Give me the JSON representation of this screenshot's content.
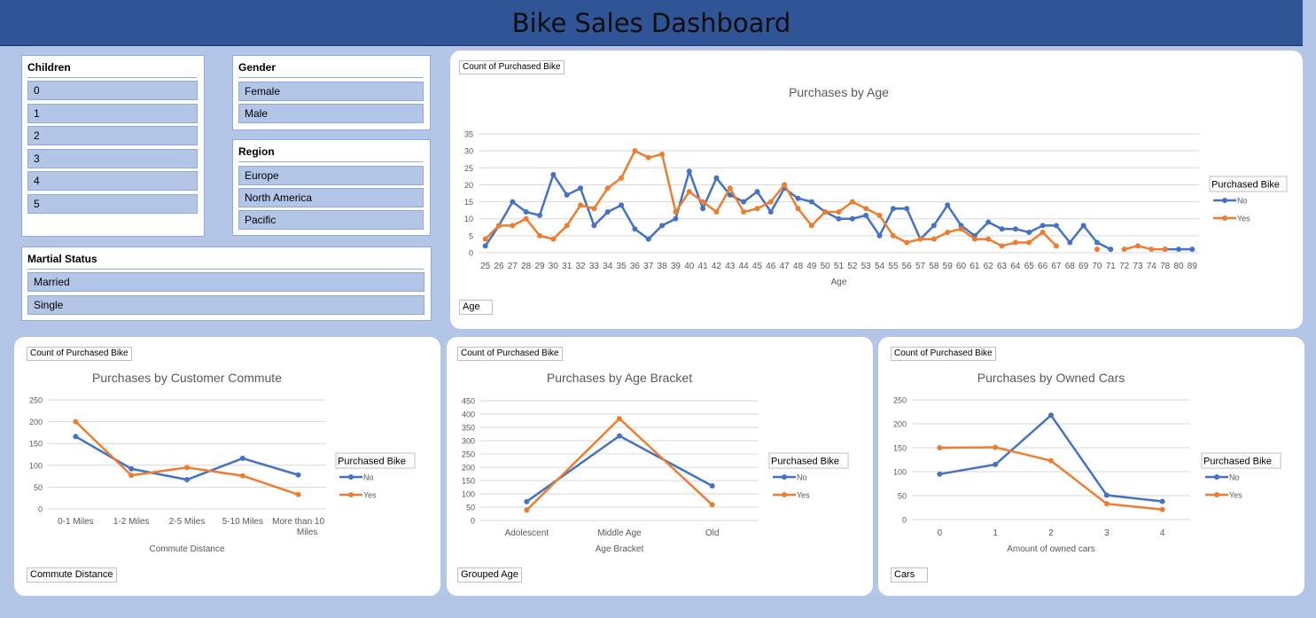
{
  "title": "Bike Sales Dashboard",
  "slicers": {
    "children": {
      "header": "Children",
      "items": [
        "0",
        "1",
        "2",
        "3",
        "4",
        "5"
      ]
    },
    "gender": {
      "header": "Gender",
      "items": [
        "Female",
        "Male"
      ]
    },
    "region": {
      "header": "Region",
      "items": [
        "Europe",
        "North America",
        "Pacific"
      ]
    },
    "marital": {
      "header": "Martial Status",
      "items": [
        "Married",
        "Single"
      ]
    }
  },
  "colors": {
    "no": "#4472c4",
    "yes": "#ed7d31",
    "banner": "#2f5597",
    "background": "#b4c6e7"
  },
  "chart_data": [
    {
      "type": "line",
      "title": "Purchases by Age",
      "xlabel": "Age",
      "ylabel": "",
      "value_field": "Count of Purchased Bike",
      "axis_field": "Age",
      "legend_title": "Purchased Bike",
      "legend_position": "right",
      "ylim": [
        0,
        35
      ],
      "yticks": [
        0,
        5,
        10,
        15,
        20,
        25,
        30,
        35
      ],
      "grid": true,
      "categories": [
        "25",
        "26",
        "27",
        "28",
        "29",
        "30",
        "31",
        "32",
        "33",
        "34",
        "35",
        "36",
        "37",
        "38",
        "39",
        "40",
        "41",
        "42",
        "43",
        "44",
        "45",
        "46",
        "47",
        "48",
        "49",
        "50",
        "51",
        "52",
        "53",
        "54",
        "55",
        "56",
        "57",
        "58",
        "59",
        "60",
        "61",
        "62",
        "63",
        "64",
        "65",
        "66",
        "67",
        "68",
        "69",
        "70",
        "71",
        "72",
        "73",
        "74",
        "78",
        "80",
        "89"
      ],
      "series": [
        {
          "name": "No",
          "values": [
            2,
            8,
            15,
            12,
            11,
            23,
            17,
            19,
            8,
            12,
            14,
            7,
            4,
            8,
            10,
            24,
            13,
            22,
            17,
            15,
            18,
            12,
            19,
            16,
            15,
            12,
            10,
            10,
            11,
            5,
            13,
            13,
            4,
            8,
            14,
            8,
            5,
            9,
            7,
            7,
            6,
            8,
            8,
            3,
            8,
            3,
            1,
            null,
            null,
            null,
            1,
            1,
            1
          ]
        },
        {
          "name": "Yes",
          "values": [
            4,
            8,
            8,
            10,
            5,
            4,
            8,
            14,
            13,
            19,
            22,
            30,
            28,
            29,
            12,
            18,
            15,
            12,
            19,
            12,
            13,
            15,
            20,
            13,
            8,
            12,
            12,
            15,
            13,
            11,
            5,
            3,
            4,
            4,
            6,
            7,
            4,
            4,
            2,
            3,
            3,
            6,
            2,
            null,
            null,
            1,
            null,
            1,
            2,
            1,
            1,
            null,
            null
          ]
        }
      ]
    },
    {
      "type": "line",
      "title": "Purchases by Customer Commute",
      "xlabel": "Commute Distance",
      "ylabel": "",
      "value_field": "Count of Purchased Bike",
      "axis_field": "Commute Distance",
      "legend_title": "Purchased Bike",
      "legend_position": "right",
      "ylim": [
        0,
        250
      ],
      "yticks": [
        0,
        50,
        100,
        150,
        200,
        250
      ],
      "grid": true,
      "categories": [
        "0-1 Miles",
        "1-2 Miles",
        "2-5 Miles",
        "5-10 Miles",
        "More than 10 Miles"
      ],
      "series": [
        {
          "name": "No",
          "values": [
            166,
            92,
            67,
            116,
            78
          ]
        },
        {
          "name": "Yes",
          "values": [
            200,
            77,
            95,
            76,
            33
          ]
        }
      ]
    },
    {
      "type": "line",
      "title": "Purchases by Age Bracket",
      "xlabel": "Age Bracket",
      "ylabel": "",
      "value_field": "Count of Purchased Bike",
      "axis_field": "Grouped Age",
      "legend_title": "Purchased Bike",
      "legend_position": "right",
      "ylim": [
        0,
        450
      ],
      "yticks": [
        0,
        50,
        100,
        150,
        200,
        250,
        300,
        350,
        400,
        450
      ],
      "grid": true,
      "categories": [
        "Adolescent",
        "Middle Age",
        "Old"
      ],
      "series": [
        {
          "name": "No",
          "values": [
            71,
            318,
            130
          ]
        },
        {
          "name": "Yes",
          "values": [
            39,
            383,
            59
          ]
        }
      ]
    },
    {
      "type": "line",
      "title": "Purchases by Owned Cars",
      "xlabel": "Amount of owned cars",
      "ylabel": "",
      "value_field": "Count of Purchased Bike",
      "axis_field": "Cars",
      "legend_title": "Purchased Bike",
      "legend_position": "right",
      "ylim": [
        0,
        250
      ],
      "yticks": [
        0,
        50,
        100,
        150,
        200,
        250
      ],
      "grid": true,
      "categories": [
        "0",
        "1",
        "2",
        "3",
        "4"
      ],
      "series": [
        {
          "name": "No",
          "values": [
            95,
            115,
            218,
            51,
            38
          ]
        },
        {
          "name": "Yes",
          "values": [
            150,
            151,
            123,
            33,
            21
          ]
        }
      ]
    }
  ]
}
